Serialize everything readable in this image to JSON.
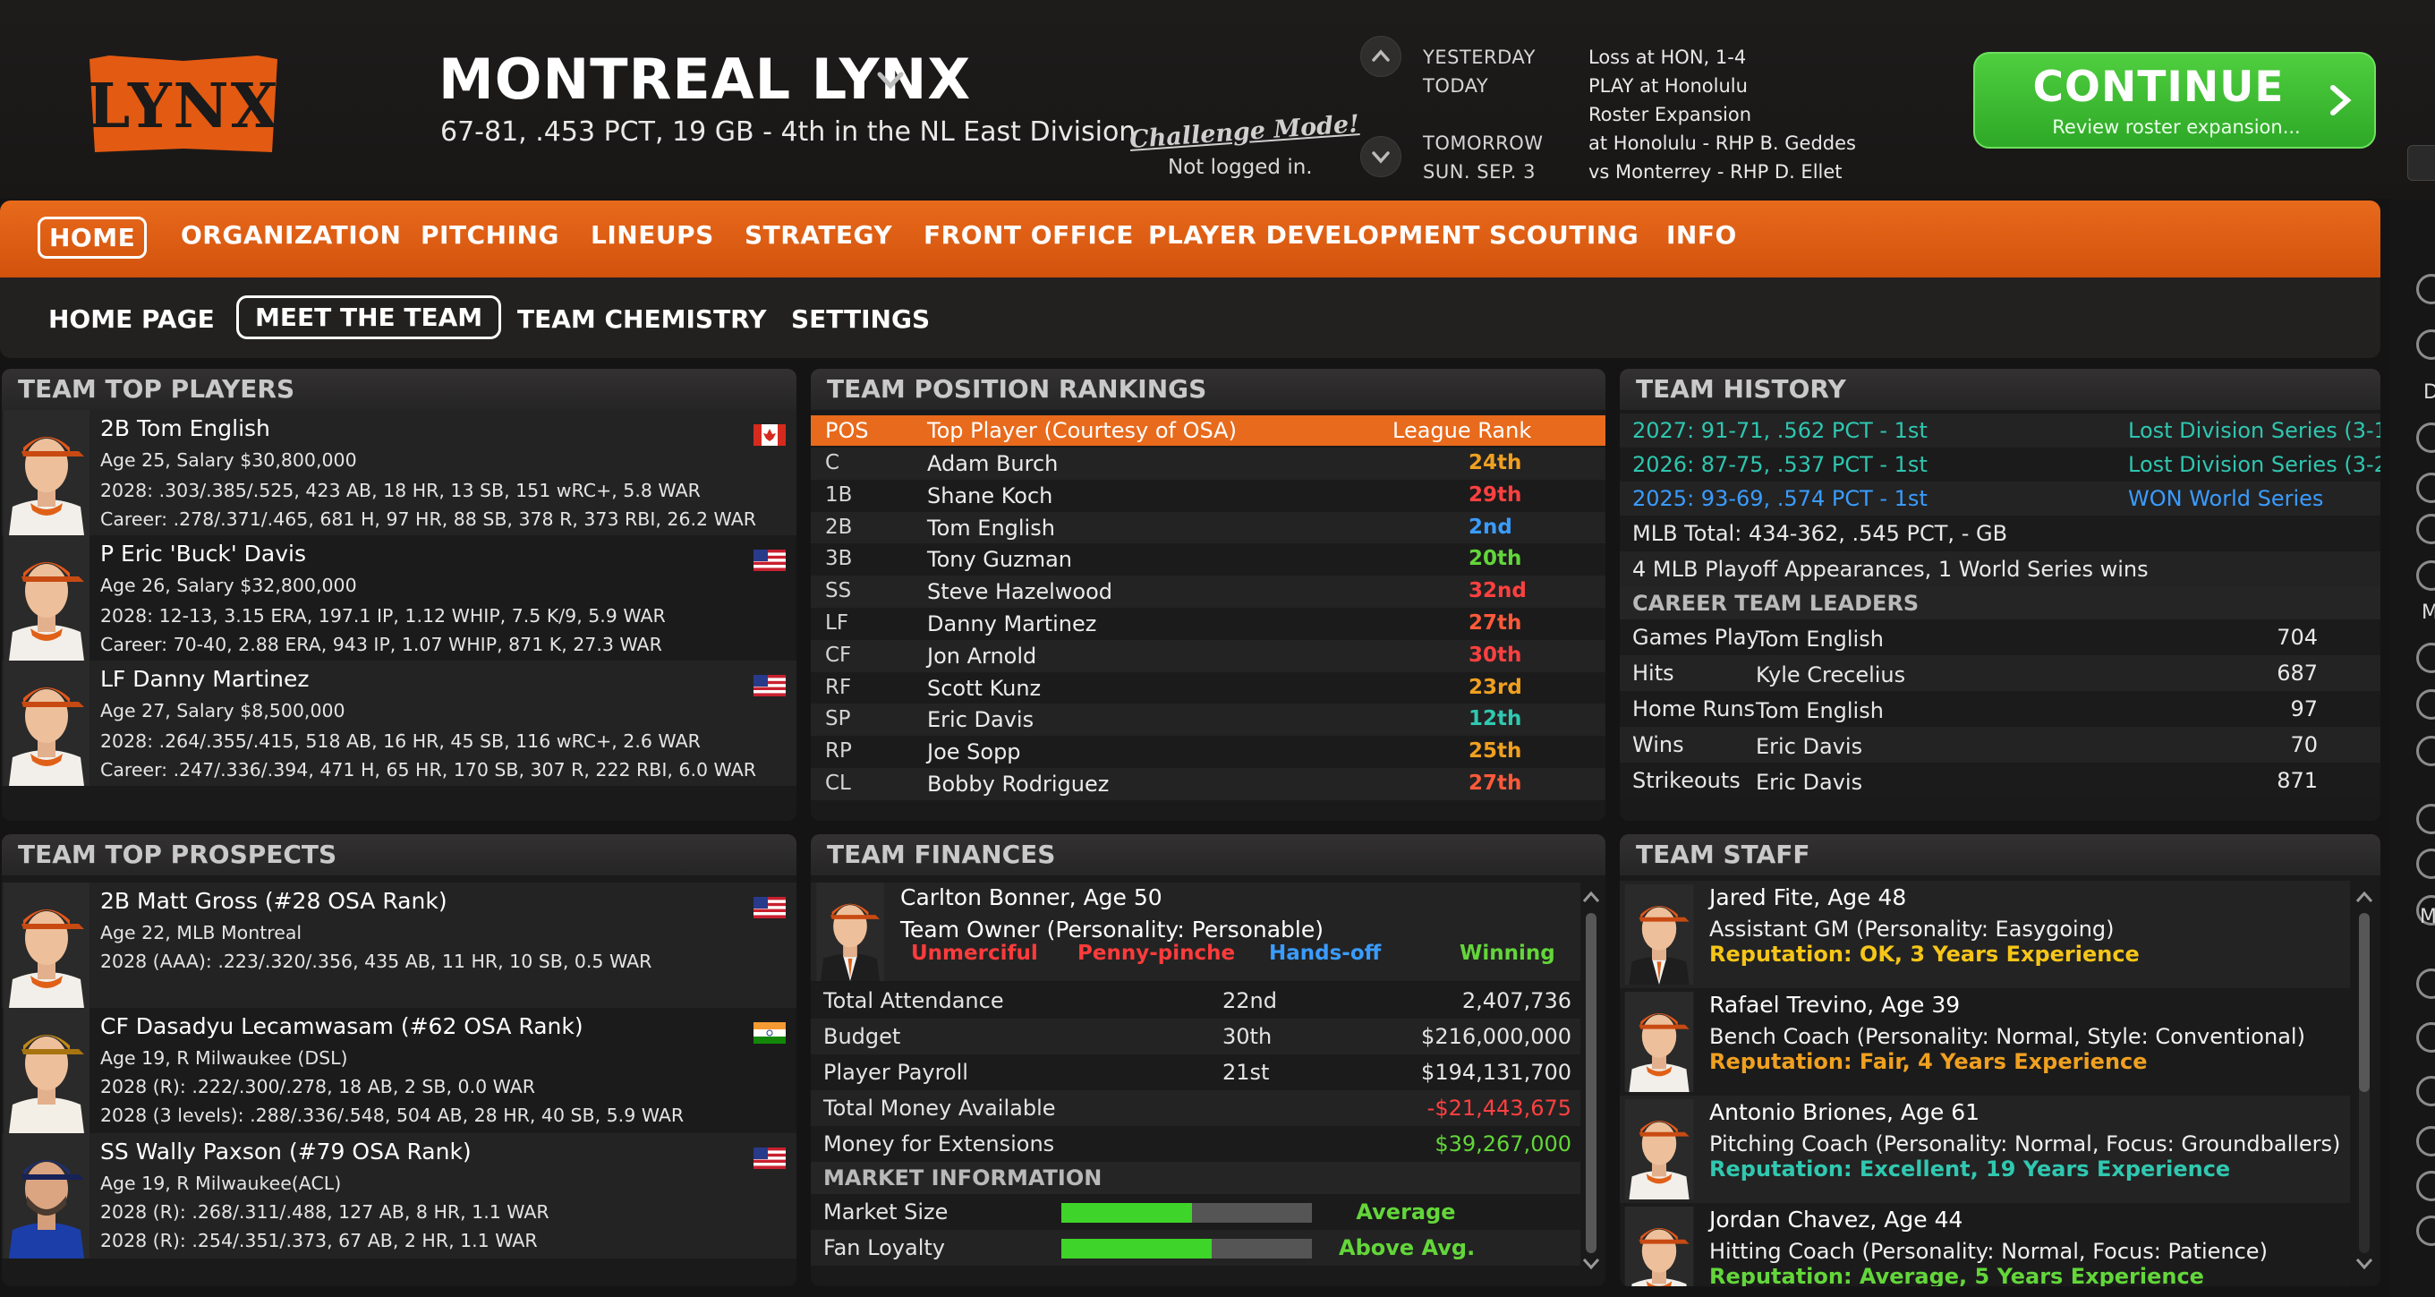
{
  "header": {
    "team_name": "MONTREAL LYNX",
    "team_record": "67-81, .453 PCT, 19 GB - 4th in the NL East Division",
    "logo_text": "LYNX",
    "challenge_mode": "Challenge Mode!",
    "login_status": "Not logged in.",
    "schedule": [
      {
        "label": "YESTERDAY",
        "value": "Loss at HON, 1-4"
      },
      {
        "label": "TODAY",
        "value": "PLAY at Honolulu"
      },
      {
        "label": "",
        "value": "Roster Expansion"
      },
      {
        "label": "TOMORROW",
        "value": "at Honolulu - RHP B. Geddes"
      },
      {
        "label": "SUN. SEP. 3",
        "value": "vs Monterrey - RHP D. Ellet"
      }
    ],
    "continue": {
      "label": "CONTINUE",
      "sublabel": "Review roster expansion..."
    }
  },
  "main_nav": [
    "HOME",
    "ORGANIZATION",
    "PITCHING",
    "LINEUPS",
    "STRATEGY",
    "FRONT OFFICE",
    "PLAYER DEVELOPMENT",
    "SCOUTING",
    "INFO"
  ],
  "main_nav_active": "HOME",
  "sub_nav": [
    "HOME PAGE",
    "MEET THE TEAM",
    "TEAM CHEMISTRY",
    "SETTINGS"
  ],
  "sub_nav_active": "MEET THE TEAM",
  "top_players": {
    "title": "TEAM TOP PLAYERS",
    "players": [
      {
        "name": "2B Tom English",
        "line1": "Age 25, Salary $30,800,000",
        "line2": "2028: .303/.385/.525, 423 AB, 18 HR, 13 SB, 151 wRC+, 5.8 WAR",
        "line3": "Career: .278/.371/.465, 681 H, 97 HR, 88 SB, 378 R, 373 RBI, 26.2 WAR",
        "flag": "canada"
      },
      {
        "name": "P Eric 'Buck' Davis",
        "line1": "Age 26, Salary $32,800,000",
        "line2": "2028: 12-13, 3.15 ERA, 197.1 IP, 1.12 WHIP, 7.5 K/9, 5.9 WAR",
        "line3": "Career: 70-40, 2.88 ERA, 943 IP, 1.07 WHIP, 871 K, 27.3 WAR",
        "flag": "usa"
      },
      {
        "name": "LF Danny Martinez",
        "line1": "Age 27, Salary $8,500,000",
        "line2": "2028: .264/.355/.415, 518 AB, 16 HR, 45 SB, 116 wRC+, 2.6 WAR",
        "line3": "Career: .247/.336/.394, 471 H, 65 HR, 170 SB, 307 R, 222 RBI, 6.0 WAR",
        "flag": "usa"
      }
    ]
  },
  "position_rankings": {
    "title": "TEAM POSITION RANKINGS",
    "headers": [
      "POS",
      "Top Player (Courtesy of OSA)",
      "League Rank"
    ],
    "rows": [
      {
        "pos": "C",
        "player": "Adam Burch",
        "rank": "24th",
        "color": "#f0a020"
      },
      {
        "pos": "1B",
        "player": "Shane Koch",
        "rank": "29th",
        "color": "#ff4040"
      },
      {
        "pos": "2B",
        "player": "Tom English",
        "rank": "2nd",
        "color": "#3a9cff"
      },
      {
        "pos": "3B",
        "player": "Tony Guzman",
        "rank": "20th",
        "color": "#63d63a"
      },
      {
        "pos": "SS",
        "player": "Steve Hazelwood",
        "rank": "32nd",
        "color": "#ff4040"
      },
      {
        "pos": "LF",
        "player": "Danny Martinez",
        "rank": "27th",
        "color": "#ff5a3a"
      },
      {
        "pos": "CF",
        "player": "Jon Arnold",
        "rank": "30th",
        "color": "#ff4040"
      },
      {
        "pos": "RF",
        "player": "Scott Kunz",
        "rank": "23rd",
        "color": "#f0a020"
      },
      {
        "pos": "SP",
        "player": "Eric Davis",
        "rank": "12th",
        "color": "#30c8b0"
      },
      {
        "pos": "RP",
        "player": "Joe Sopp",
        "rank": "25th",
        "color": "#f0a020"
      },
      {
        "pos": "CL",
        "player": "Bobby Rodriguez",
        "rank": "27th",
        "color": "#ff5a3a"
      }
    ]
  },
  "team_history": {
    "title": "TEAM HISTORY",
    "seasons": [
      {
        "season": "2027: 91-71, .562 PCT - 1st",
        "result": "Lost Division Series (3-1",
        "color": "#2fc6b0"
      },
      {
        "season": "2026: 87-75, .537 PCT - 1st",
        "result": "Lost Division Series (3-2",
        "color": "#2fc6b0"
      },
      {
        "season": "2025: 93-69, .574 PCT - 1st",
        "result": "WON World Series",
        "color": "#3a9cff"
      }
    ],
    "mlb_total": "MLB Total: 434-362, .545 PCT, - GB",
    "playoffs": "4 MLB Playoff Appearances, 1 World Series wins",
    "leaders_title": "CAREER TEAM LEADERS",
    "leaders": [
      {
        "stat": "Games Playe",
        "player": "Tom English",
        "value": "704"
      },
      {
        "stat": "Hits",
        "player": "Kyle Crecelius",
        "value": "687"
      },
      {
        "stat": "Home Runs",
        "player": "Tom English",
        "value": "97"
      },
      {
        "stat": "Wins",
        "player": "Eric Davis",
        "value": "70"
      },
      {
        "stat": "Strikeouts",
        "player": "Eric Davis",
        "value": "871"
      }
    ]
  },
  "top_prospects": {
    "title": "TEAM TOP PROSPECTS",
    "players": [
      {
        "name": "2B Matt Gross (#28 OSA Rank)",
        "line1": "Age 22, MLB Montreal",
        "line2": "2028 (AAA): .223/.320/.356, 435 AB, 11 HR, 10 SB, 0.5 WAR",
        "line3": "",
        "flag": "usa"
      },
      {
        "name": "CF Dasadyu Lecamwasam (#62 OSA Rank)",
        "line1": "Age 19, R Milwaukee (DSL)",
        "line2": "2028 (R): .222/.300/.278, 18 AB, 2 SB, 0.0 WAR",
        "line3": "2028 (3 levels): .288/.336/.548, 504 AB, 28 HR, 40 SB, 5.9 WAR",
        "flag": "india"
      },
      {
        "name": "SS Wally Paxson (#79 OSA Rank)",
        "line1": "Age 19, R Milwaukee(ACL)",
        "line2": "2028 (R): .268/.311/.488, 127 AB, 8 HR, 1.1 WAR",
        "line3": "2028 (R): .254/.351/.373, 67 AB, 2 HR, 1.1 WAR",
        "flag": "usa"
      }
    ]
  },
  "finances": {
    "title": "TEAM FINANCES",
    "owner_name": "Carlton Bonner, Age 50",
    "owner_role": "Team Owner (Personality: Personable)",
    "traits": [
      {
        "label": "Unmerciful",
        "color": "#ff3b3b"
      },
      {
        "label": "Penny-pinche",
        "color": "#ff3b3b"
      },
      {
        "label": "Hands-off",
        "color": "#3a9cff"
      },
      {
        "label": "Winning",
        "color": "#63d63a"
      }
    ],
    "rows": [
      {
        "label": "Total Attendance",
        "rank": "22nd",
        "value": "2,407,736",
        "color": "#e4e4e4"
      },
      {
        "label": "Budget",
        "rank": "30th",
        "value": "$216,000,000",
        "color": "#e4e4e4"
      },
      {
        "label": "Player Payroll",
        "rank": "21st",
        "value": "$194,131,700",
        "color": "#e4e4e4"
      },
      {
        "label": "Total Money Available",
        "rank": "",
        "value": "-$21,443,675",
        "color": "#ff4040"
      },
      {
        "label": "Money for Extensions",
        "rank": "",
        "value": "$39,267,000",
        "color": "#63d63a"
      }
    ],
    "market_title": "MARKET INFORMATION",
    "market": [
      {
        "label": "Market Size",
        "value_text": "Average",
        "fill": 0.52
      },
      {
        "label": "Fan Loyalty",
        "value_text": "Above Avg.",
        "fill": 0.6
      }
    ]
  },
  "staff": {
    "title": "TEAM STAFF",
    "members": [
      {
        "name": "Jared Fite, Age 48",
        "role": "Assistant GM (Personality: Easygoing)",
        "rep": "Reputation: OK, 3 Years Experience",
        "rep_color": "#f5c518"
      },
      {
        "name": "Rafael Trevino, Age 39",
        "role": "Bench Coach (Personality: Normal, Style: Conventional)",
        "rep": "Reputation: Fair, 4 Years Experience",
        "rep_color": "#f0a020"
      },
      {
        "name": "Antonio Briones, Age 61",
        "role": "Pitching Coach (Personality: Normal, Focus: Groundballers)",
        "rep": "Reputation: Excellent, 19 Years Experience",
        "rep_color": "#30c8b0"
      },
      {
        "name": "Jordan Chavez, Age 44",
        "role": "Hitting Coach (Personality: Normal, Focus: Patience)",
        "rep": "Reputation: Average, 5 Years Experience",
        "rep_color": "#63d63a"
      }
    ]
  },
  "right_sidebar_letters": [
    "D",
    "M",
    "M"
  ],
  "colors": {
    "accent_orange": "#e06018",
    "green": "#2ea827",
    "bg": "#141414"
  }
}
